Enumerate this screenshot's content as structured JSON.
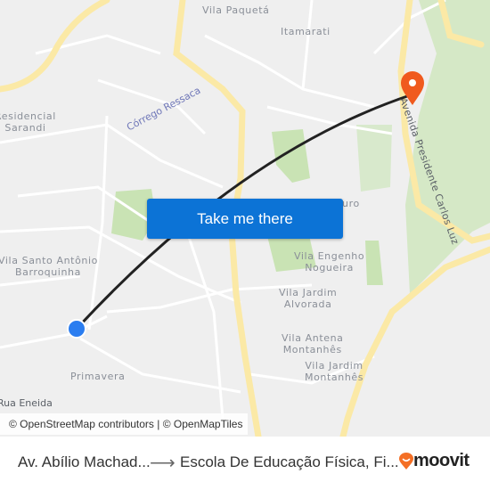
{
  "map": {
    "neighborhood_labels": [
      {
        "id": "vila-paqueta",
        "text": "Vila Paquetá"
      },
      {
        "id": "itamarati",
        "text": "Itamarati"
      },
      {
        "id": "residencial-sarandi",
        "line1": "Residencial",
        "line2": "Sarandi"
      },
      {
        "id": "vila-santo-antonio",
        "line1": "Vila Santo Antônio",
        "line2": "Barroquinha"
      },
      {
        "id": "primavera",
        "text": "Primavera"
      },
      {
        "id": "vila-engenho-nogueira",
        "line1": "Vila Engenho",
        "line2": "Nogueira"
      },
      {
        "id": "vila-jardim-alvorada",
        "line1": "Vila Jardim",
        "line2": "Alvorada"
      },
      {
        "id": "vila-antena-montanhes",
        "line1": "Vila Antena",
        "line2": "Montanhês"
      },
      {
        "id": "vila-jardim-montanhes",
        "line1": "Vila Jardim",
        "line2": "Montanhês"
      },
      {
        "id": "partial-uro",
        "text": "uro"
      }
    ],
    "water_label": "Córrego Ressaca",
    "street_labels": {
      "rua_eneida": "Rua Eneida",
      "avenida": "Avenida Presidente Carlos Luz"
    },
    "colors": {
      "background": "#efefef",
      "major_road": "#fbe9a6",
      "park": "#c9e3b4",
      "route_line": "#222222",
      "origin_marker": "#2a7df0",
      "destination_marker": "#f05a1e"
    }
  },
  "cta": {
    "label": "Take me there"
  },
  "attribution": "© OpenStreetMap contributors | © OpenMapTiles",
  "footer": {
    "origin": "Av. Abílio Machad...",
    "arrow": "⟶",
    "destination": "Escola De Educação Física, Fi...",
    "brand": "moovit",
    "brand_color": "#f46f25"
  }
}
